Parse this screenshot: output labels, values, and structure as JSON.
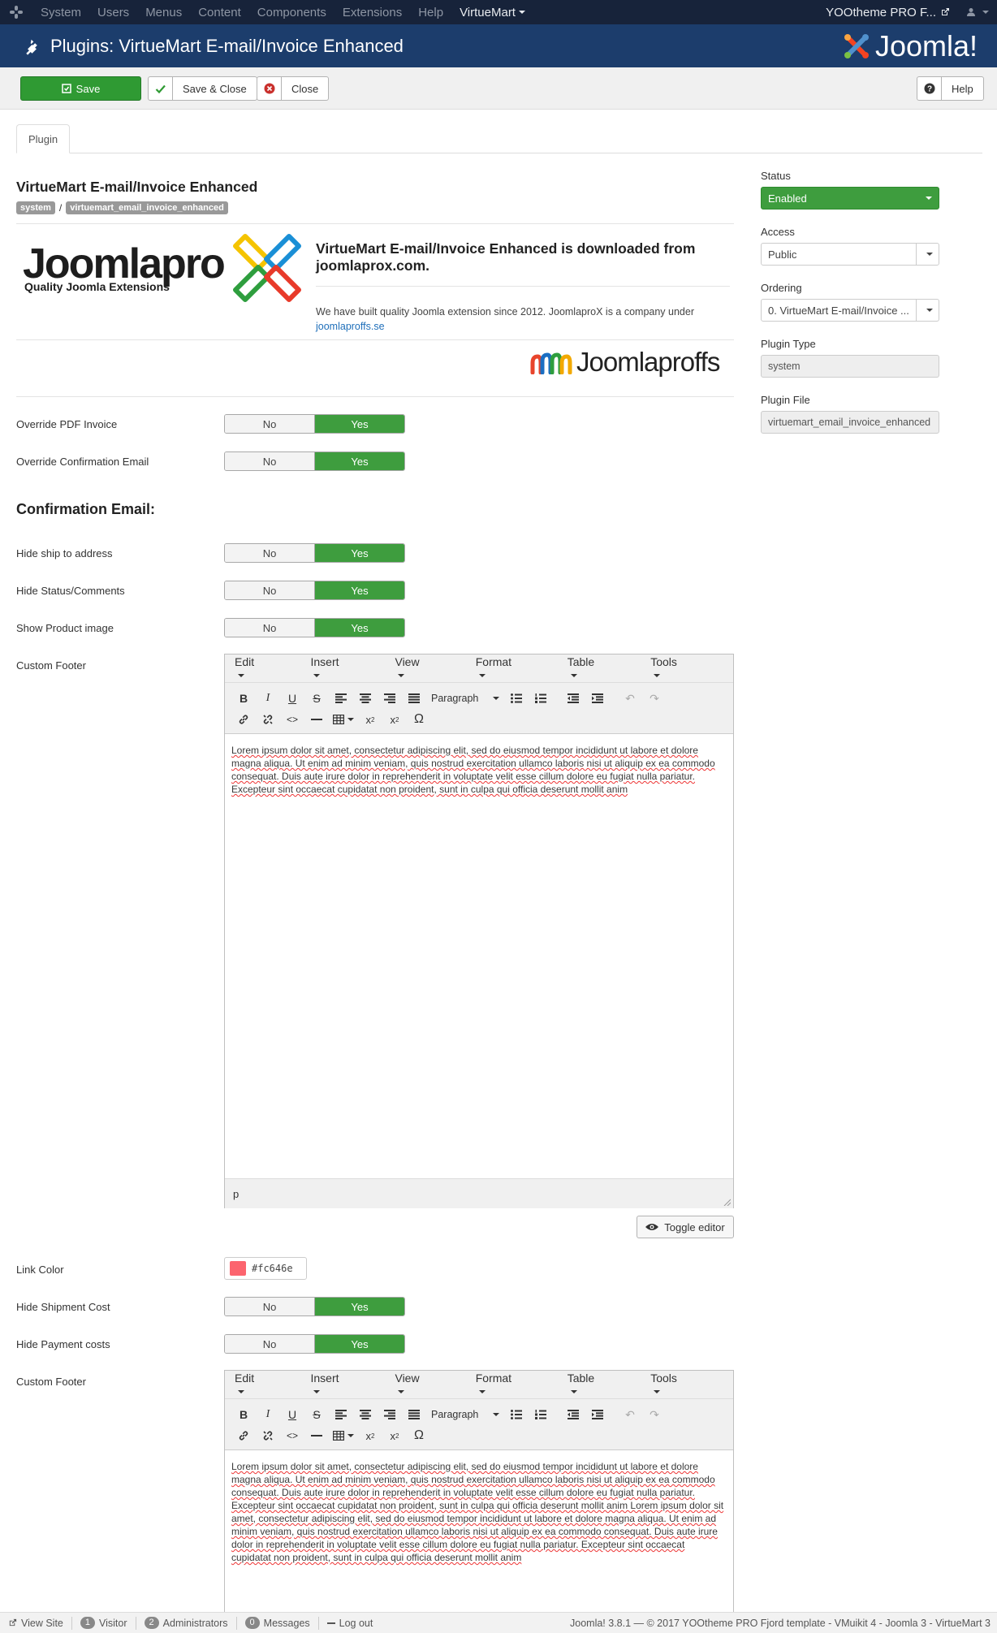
{
  "navbar": {
    "menu": [
      "System",
      "Users",
      "Menus",
      "Content",
      "Components",
      "Extensions",
      "Help"
    ],
    "active_menu": "VirtueMart",
    "site_name": "YOOtheme PRO F..."
  },
  "header": {
    "title": "Plugins: VirtueMart E-mail/Invoice Enhanced",
    "brand": "Joomla!"
  },
  "toolbar": {
    "save": "Save",
    "save_close": "Save & Close",
    "close": "Close",
    "help": "Help"
  },
  "tabs": [
    "Plugin"
  ],
  "plugin": {
    "title": "VirtueMart E-mail/Invoice Enhanced",
    "badge_folder": "system",
    "badge_element": "virtuemart_email_invoice_enhanced"
  },
  "promo": {
    "logo_text": "Joomlapro",
    "logo_tagline": "Quality Joomla Extensions",
    "heading": "VirtueMart E-mail/Invoice Enhanced is downloaded from joomlaprox.com.",
    "text": "We have built quality Joomla extension since 2012. JoomlaproX is a company under",
    "link": "joomlaproffs.se",
    "proffs_logo_text": "Joomlaproffs"
  },
  "toggle_labels": {
    "no": "No",
    "yes": "Yes"
  },
  "fields": {
    "override_pdf": {
      "label": "Override PDF Invoice",
      "value": "Yes"
    },
    "override_conf": {
      "label": "Override Confirmation Email",
      "value": "Yes"
    },
    "section_title": "Confirmation Email:",
    "hide_ship": {
      "label": "Hide ship to address",
      "value": "Yes"
    },
    "hide_status": {
      "label": "Hide Status/Comments",
      "value": "Yes"
    },
    "show_image": {
      "label": "Show Product image",
      "value": "Yes"
    },
    "custom_footer_1": {
      "label": "Custom Footer"
    },
    "link_color": {
      "label": "Link Color",
      "value": "#fc646e",
      "color": "#fc646e"
    },
    "hide_shipment": {
      "label": "Hide Shipment Cost",
      "value": "Yes"
    },
    "hide_payment": {
      "label": "Hide Payment costs",
      "value": "Yes"
    },
    "custom_footer_2": {
      "label": "Custom Footer"
    }
  },
  "editor": {
    "menu": [
      "Edit",
      "Insert",
      "View",
      "Format",
      "Table",
      "Tools"
    ],
    "paragraph": "Paragraph",
    "statusbar_path": "p",
    "toggle_editor": "Toggle editor",
    "content_1": "Lorem ipsum dolor sit amet, consectetur adipiscing elit, sed do eiusmod tempor incididunt ut labore et dolore magna aliqua. Ut enim ad minim veniam, quis nostrud exercitation ullamco laboris nisi ut aliquip ex ea commodo consequat. Duis aute irure dolor in reprehenderit in voluptate velit esse cillum dolore eu fugiat nulla pariatur. Excepteur sint occaecat cupidatat non proident, sunt in culpa qui officia deserunt mollit anim",
    "content_2": "Lorem ipsum dolor sit amet, consectetur adipiscing elit, sed do eiusmod tempor incididunt ut labore et dolore magna aliqua. Ut enim ad minim veniam, quis nostrud exercitation ullamco laboris nisi ut aliquip ex ea commodo consequat. Duis aute irure dolor in reprehenderit in voluptate velit esse cillum dolore eu fugiat nulla pariatur. Excepteur sint occaecat cupidatat non proident, sunt in culpa qui officia deserunt mollit anim Lorem ipsum dolor sit amet, consectetur adipiscing elit, sed do eiusmod tempor incididunt ut labore et dolore magna aliqua. Ut enim ad minim veniam, quis nostrud exercitation ullamco laboris nisi ut aliquip ex ea commodo consequat. Duis aute irure dolor in reprehenderit in voluptate velit esse cillum dolore eu fugiat nulla pariatur. Excepteur sint occaecat cupidatat non proident, sunt in culpa qui officia deserunt mollit anim"
  },
  "sidebar": {
    "status_label": "Status",
    "status_value": "Enabled",
    "access_label": "Access",
    "access_value": "Public",
    "ordering_label": "Ordering",
    "ordering_value": "0. VirtueMart E-mail/Invoice ...",
    "type_label": "Plugin Type",
    "type_value": "system",
    "file_label": "Plugin File",
    "file_value": "virtuemart_email_invoice_enhanced"
  },
  "statusbar": {
    "view_site": "View Site",
    "visitors_count": "1",
    "visitors": "Visitor",
    "admins_count": "2",
    "admins": "Administrators",
    "messages_count": "0",
    "messages": "Messages",
    "logout": "Log out",
    "copyright": "Joomla! 3.8.1  —  © 2017 YOOtheme PRO Fjord template - VMuikit 4 - Joomla 3 - VirtueMart 3"
  },
  "colors": {
    "navbar": "#17233a",
    "header": "#1c3d6c",
    "success": "#3e9d3e",
    "link": "#1f6fba"
  }
}
